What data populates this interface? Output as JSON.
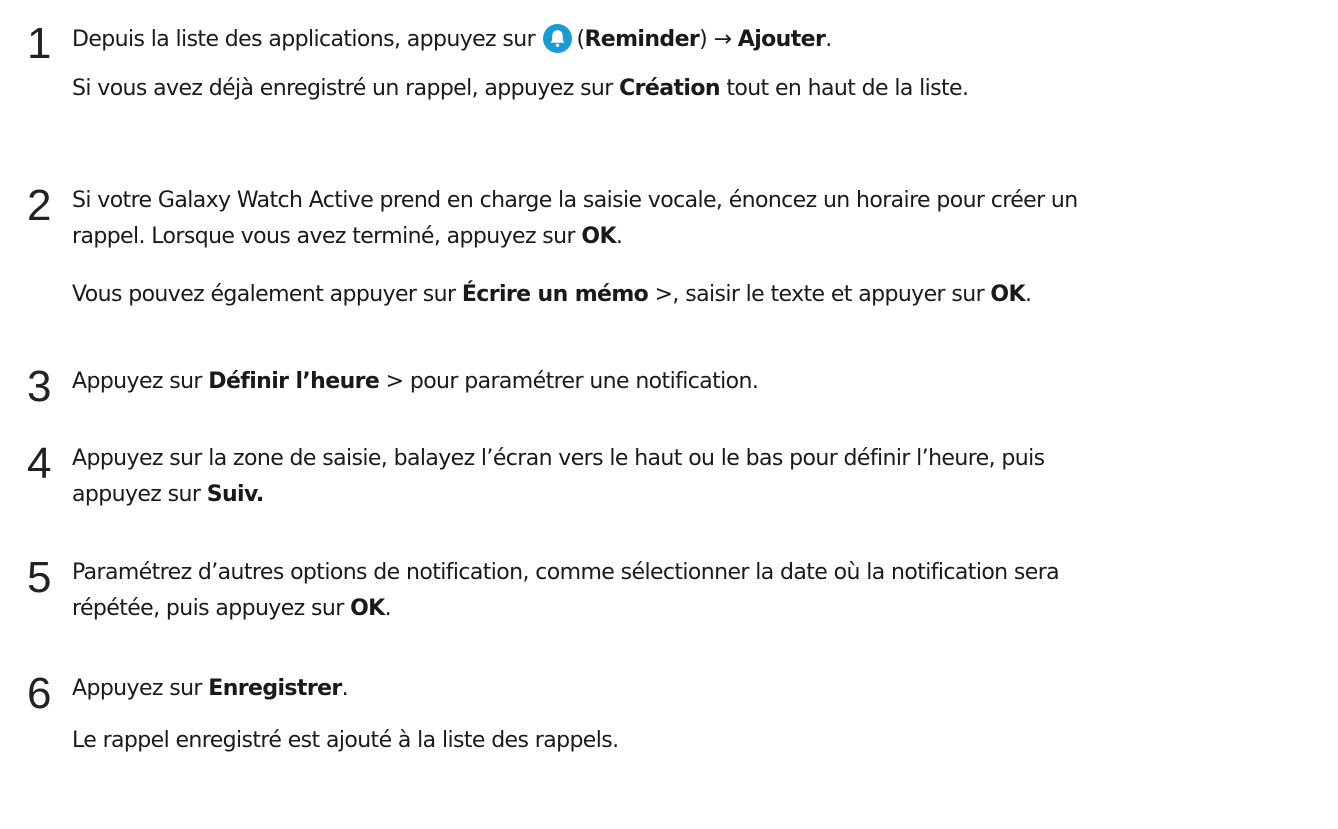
{
  "steps": [
    {
      "number": "1",
      "line1": {
        "prefix": "Depuis la liste des applications, appuyez sur",
        "icon": "reminder-bell-icon",
        "paren_open": "(",
        "app_name": "Reminder",
        "paren_close": ")",
        "arrow": "→",
        "action": "Ajouter",
        "end": "."
      },
      "line2": {
        "prefix": "Si vous avez déjà enregistré un rappel, appuyez sur",
        "bold": "Création",
        "suffix": "tout en haut de la liste."
      }
    },
    {
      "number": "2",
      "line1": "Si votre Galaxy Watch Active prend en charge la saisie vocale, énoncez un horaire pour créer un",
      "line2": {
        "prefix": "rappel. Lorsque vous avez terminé, appuyez sur",
        "bold": "OK",
        "end": "."
      },
      "line3": {
        "prefix": "Vous pouvez également appuyer sur",
        "bold1": "Écrire un mémo",
        "mid": " >, saisir le texte et appuyer sur",
        "bold2": "OK",
        "end": "."
      }
    },
    {
      "number": "3",
      "line1": {
        "prefix": "Appuyez sur",
        "bold": "Définir l’heure",
        "suffix": " > pour paramétrer une notification."
      }
    },
    {
      "number": "4",
      "line1": "Appuyez sur la zone de saisie, balayez l’écran vers le haut ou le bas pour définir l’heure, puis",
      "line2": {
        "prefix": "appuyez sur",
        "bold": "Suiv."
      }
    },
    {
      "number": "5",
      "line1": "Paramétrez d’autres options de notification, comme sélectionner la date où la notification sera",
      "line2": {
        "prefix": "répétée, puis appuyez sur",
        "bold": "OK",
        "end": "."
      }
    },
    {
      "number": "6",
      "line1": {
        "prefix": "Appuyez sur",
        "bold": "Enregistrer",
        "end": "."
      },
      "line2": "Le rappel enregistré est ajouté à la liste des rappels."
    }
  ],
  "colors": {
    "text": "#1a1a1a",
    "reminder_icon_bg": "#1a9bd8",
    "reminder_icon_fg": "#ffffff"
  }
}
